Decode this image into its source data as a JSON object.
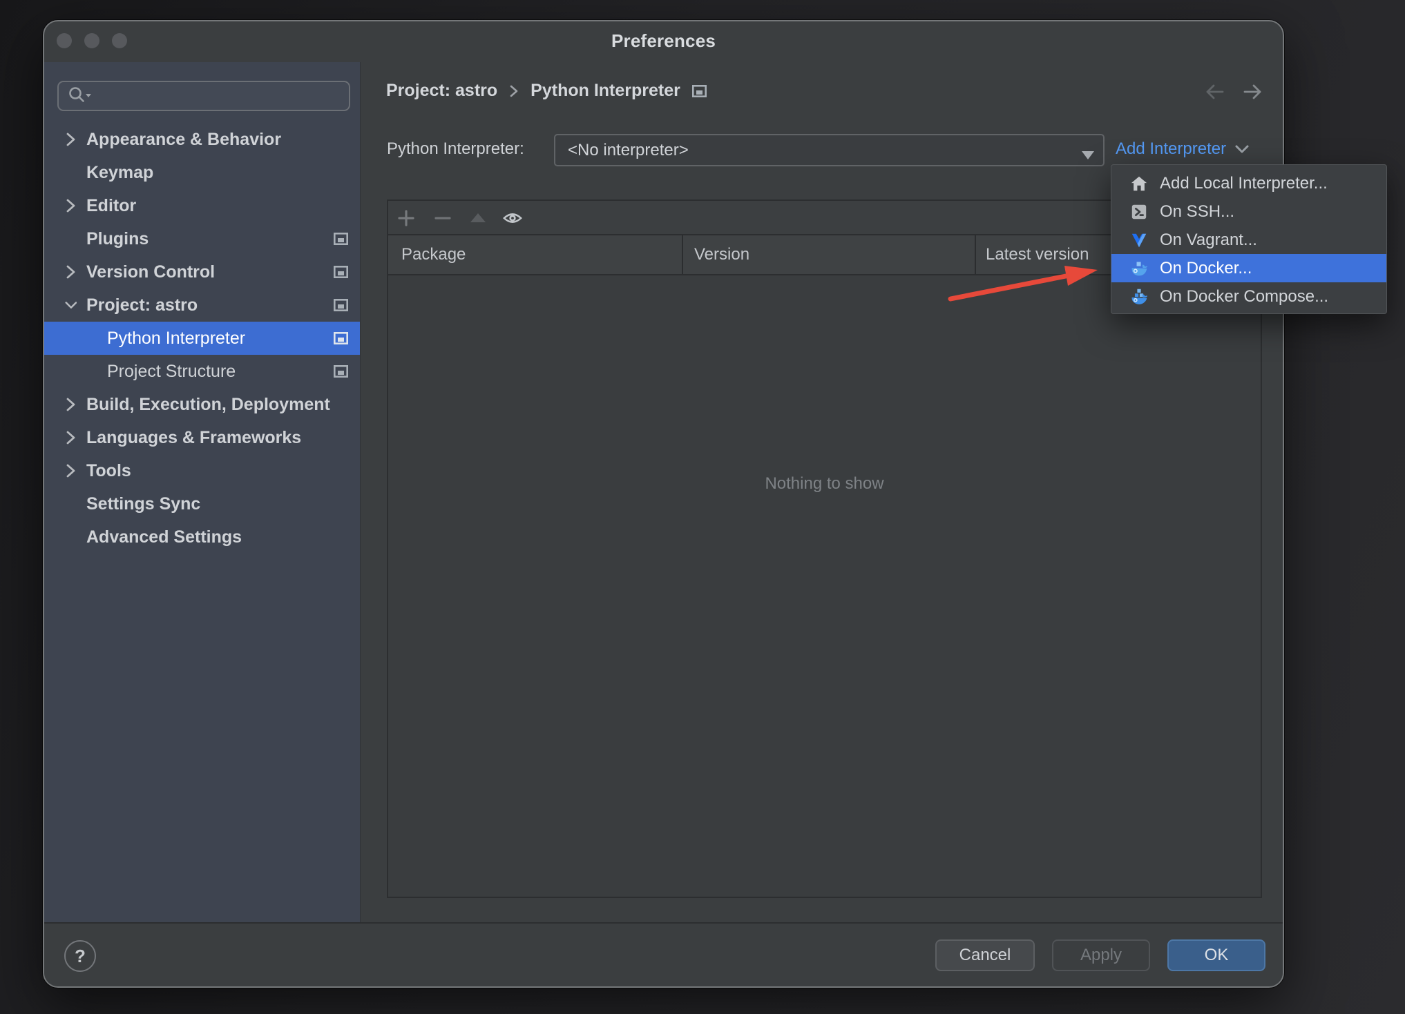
{
  "window": {
    "title": "Preferences"
  },
  "sidebar": {
    "search": {
      "value": "",
      "icon": "search-icon"
    },
    "items": [
      {
        "label": "Appearance & Behavior",
        "level": 0,
        "bold": true,
        "chevron": "right",
        "panel_icon": false,
        "selected": false
      },
      {
        "label": "Keymap",
        "level": 0,
        "bold": true,
        "chevron": null,
        "panel_icon": false,
        "selected": false
      },
      {
        "label": "Editor",
        "level": 0,
        "bold": true,
        "chevron": "right",
        "panel_icon": false,
        "selected": false
      },
      {
        "label": "Plugins",
        "level": 0,
        "bold": true,
        "chevron": null,
        "panel_icon": true,
        "selected": false
      },
      {
        "label": "Version Control",
        "level": 0,
        "bold": true,
        "chevron": "right",
        "panel_icon": true,
        "selected": false
      },
      {
        "label": "Project: astro",
        "level": 0,
        "bold": true,
        "chevron": "down",
        "panel_icon": true,
        "selected": false
      },
      {
        "label": "Python Interpreter",
        "level": 1,
        "bold": false,
        "chevron": null,
        "panel_icon": true,
        "selected": true
      },
      {
        "label": "Project Structure",
        "level": 1,
        "bold": false,
        "chevron": null,
        "panel_icon": true,
        "selected": false
      },
      {
        "label": "Build, Execution, Deployment",
        "level": 0,
        "bold": true,
        "chevron": "right",
        "panel_icon": false,
        "selected": false
      },
      {
        "label": "Languages & Frameworks",
        "level": 0,
        "bold": true,
        "chevron": "right",
        "panel_icon": false,
        "selected": false
      },
      {
        "label": "Tools",
        "level": 0,
        "bold": true,
        "chevron": "right",
        "panel_icon": false,
        "selected": false
      },
      {
        "label": "Settings Sync",
        "level": 0,
        "bold": true,
        "chevron": null,
        "panel_icon": false,
        "selected": false
      },
      {
        "label": "Advanced Settings",
        "level": 0,
        "bold": true,
        "chevron": null,
        "panel_icon": false,
        "selected": false
      }
    ]
  },
  "breadcrumb": {
    "items": [
      "Project: astro",
      "Python Interpreter"
    ],
    "separator_icon": "chevron-right-icon",
    "trailing_icon": "external-panel-icon"
  },
  "interpreter": {
    "label": "Python Interpreter:",
    "value": "<No interpreter>",
    "add_link": "Add Interpreter"
  },
  "add_interpreter_menu": {
    "items": [
      {
        "label": "Add Local Interpreter...",
        "icon": "home-icon",
        "selected": false
      },
      {
        "label": "On SSH...",
        "icon": "ssh-terminal-icon",
        "selected": false
      },
      {
        "label": "On Vagrant...",
        "icon": "vagrant-icon",
        "selected": false
      },
      {
        "label": "On Docker...",
        "icon": "docker-icon",
        "selected": true
      },
      {
        "label": "On Docker Compose...",
        "icon": "docker-compose-icon",
        "selected": false
      }
    ]
  },
  "table": {
    "columns": [
      "Package",
      "Version",
      "Latest version"
    ],
    "rows": [],
    "empty_text": "Nothing to show",
    "toolbar_icons": [
      "plus-icon",
      "minus-icon",
      "upgrade-triangle-icon",
      "eye-icon"
    ]
  },
  "footer": {
    "help_label": "?",
    "buttons": [
      {
        "label": "Cancel",
        "enabled": true,
        "kind": "normal"
      },
      {
        "label": "Apply",
        "enabled": false,
        "kind": "disabled"
      },
      {
        "label": "OK",
        "enabled": true,
        "kind": "primary"
      }
    ]
  },
  "colors": {
    "selection_blue": "#3d6dd2",
    "menu_selection_blue": "#3e72db",
    "link_blue": "#549af5",
    "ok_button_blue": "#3a5f8b",
    "annotation_red": "#e7493a",
    "sidebar_background": "#3e4450",
    "dialog_background": "#3b3e40"
  }
}
